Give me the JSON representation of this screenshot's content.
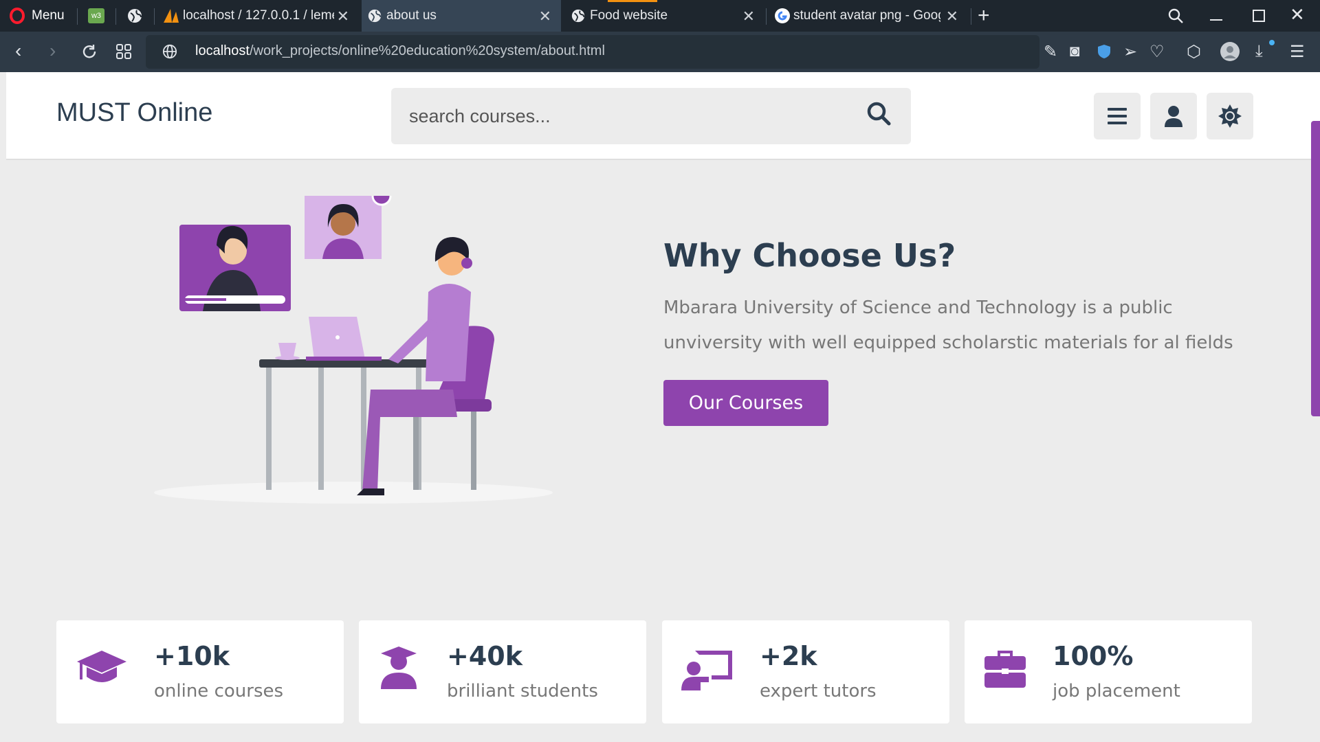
{
  "browser": {
    "menu_label": "Menu",
    "tabs": [
      {
        "title": "localhost / 127.0.0.1 / leme"
      },
      {
        "title": "about us"
      },
      {
        "title": "Food website"
      },
      {
        "title": "student avatar png - Googl"
      }
    ],
    "url_host": "localhost",
    "url_path": "/work_projects/online%20education%20system/about.html"
  },
  "header": {
    "logo": "MUST Online",
    "search_placeholder": "search courses..."
  },
  "hero": {
    "title": "Why Choose Us?",
    "text": "Mbarara University of Science and Technology is a public unviversity with well equipped scholarstic materials for al fields",
    "button": "Our Courses"
  },
  "stats": [
    {
      "value": "+10k",
      "label": "online courses",
      "icon": "graduation-cap-icon"
    },
    {
      "value": "+40k",
      "label": "brilliant students",
      "icon": "user-graduate-icon"
    },
    {
      "value": "+2k",
      "label": "expert tutors",
      "icon": "chalkboard-teacher-icon"
    },
    {
      "value": "100%",
      "label": "job placement",
      "icon": "briefcase-icon"
    }
  ],
  "colors": {
    "accent": "#8e44ad",
    "dark_text": "#2c3e50",
    "muted_text": "#777777",
    "page_bg": "#ececec",
    "chrome_bg": "#1e262e"
  }
}
